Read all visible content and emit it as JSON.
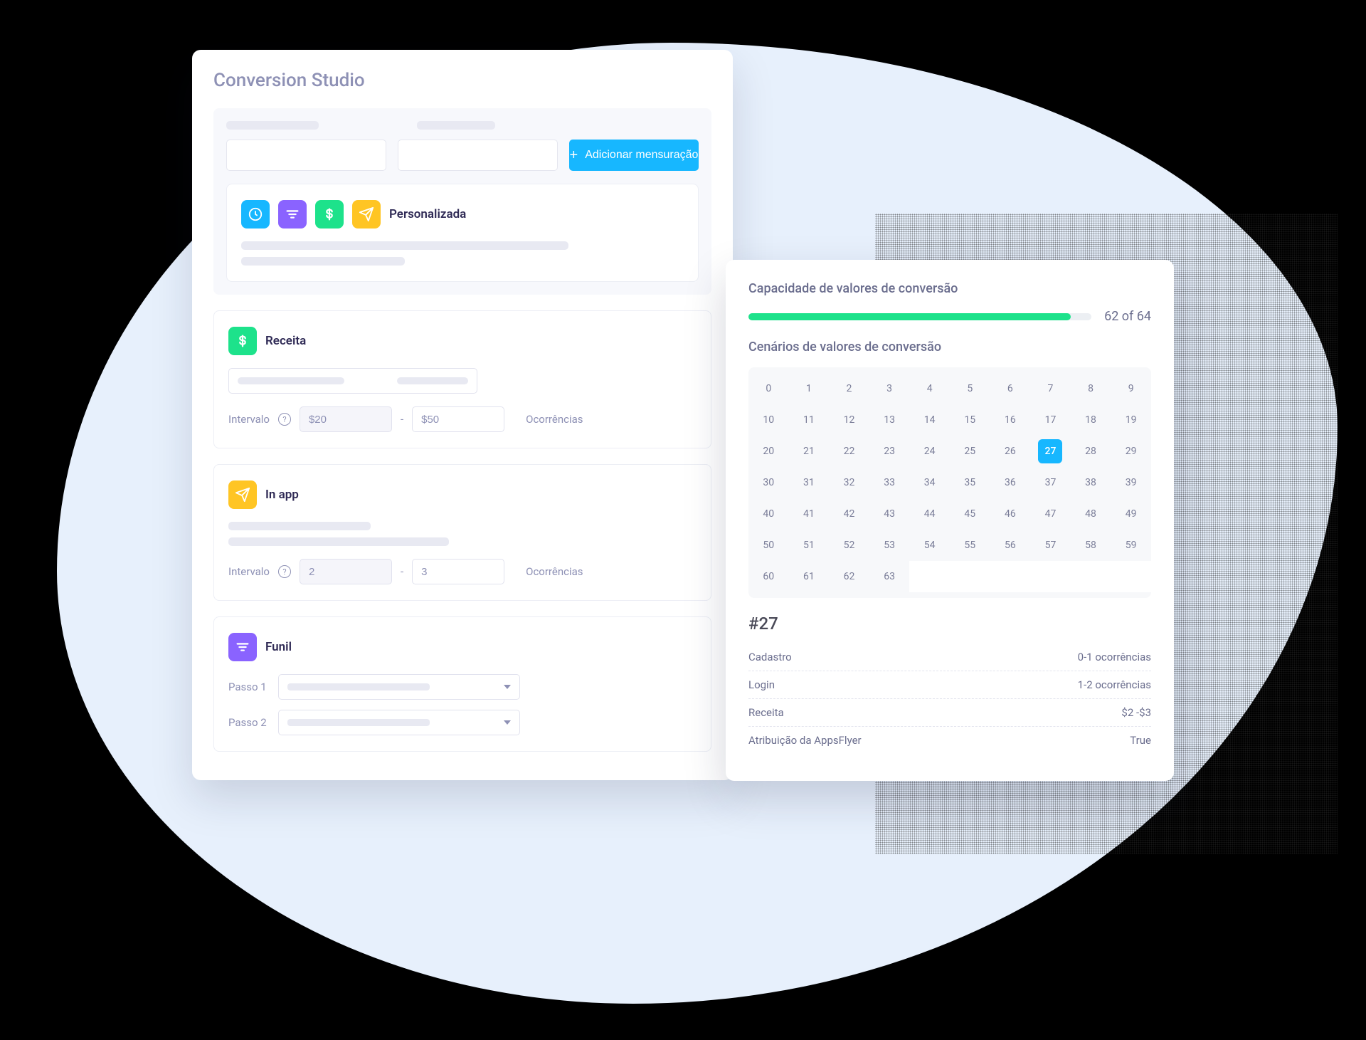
{
  "page": {
    "title": "Conversion Studio"
  },
  "top": {
    "add_button": "Adicionar mensuração"
  },
  "custom": {
    "title": "Personalizada"
  },
  "revenue": {
    "title": "Receita",
    "interval_label": "Intervalo",
    "occurrences_label": "Ocorrências",
    "from": "$20",
    "to": "$50"
  },
  "inapp": {
    "title": "In app",
    "interval_label": "Intervalo",
    "occurrences_label": "Ocorrências",
    "from": "2",
    "to": "3"
  },
  "funnel": {
    "title": "Funil",
    "step1": "Passo 1",
    "step2": "Passo 2"
  },
  "right": {
    "capacity_title": "Capacidade de valores de conversão",
    "bar_label": "62 of 64",
    "scenarios_title": "Cenários de valores de conversão",
    "selected_value": 27,
    "selected_label": "#27",
    "grid_max": 63,
    "details": [
      {
        "label": "Cadastro",
        "value": "0-1 ocorrências"
      },
      {
        "label": "Login",
        "value": "1-2 ocorrências"
      },
      {
        "label": "Receita",
        "value": "$2 -$3"
      },
      {
        "label": "Atribuição da AppsFlyer",
        "value": "True"
      }
    ]
  }
}
